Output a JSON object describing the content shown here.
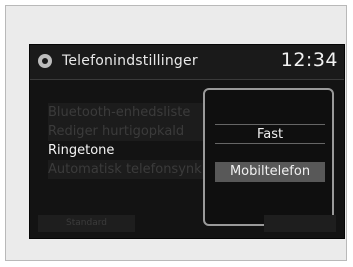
{
  "header": {
    "title": "Telefonindstillinger",
    "clock": "12:34",
    "icon": "gear-icon"
  },
  "menu": {
    "items": [
      {
        "label": "Bluetooth-enhedsliste",
        "state": "dimmed"
      },
      {
        "label": "Rediger hurtigopkald",
        "state": "dimmed"
      },
      {
        "label": "Ringetone",
        "state": "active"
      },
      {
        "label": "Automatisk telefonsynk",
        "state": "dimmed"
      }
    ]
  },
  "popup": {
    "options": [
      {
        "label": "Fast",
        "selected": false
      },
      {
        "label": "Mobiltelefon",
        "selected": true
      }
    ]
  },
  "softkeys": {
    "left": "Standard"
  }
}
